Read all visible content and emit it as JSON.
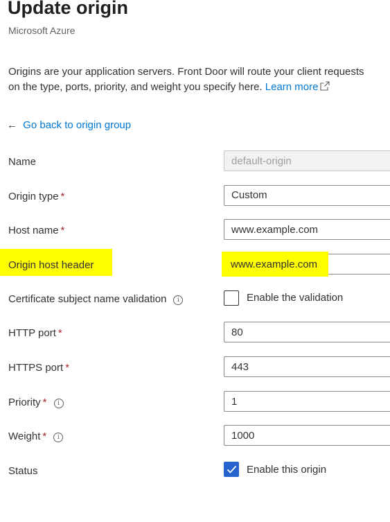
{
  "header": {
    "title": "Update origin",
    "subtitle": "Microsoft Azure"
  },
  "description": {
    "line1": "Origins are your application servers. Front Door will route your client requests",
    "line2": "on the type, ports, priority, and weight you specify here.",
    "learn_more": "Learn more"
  },
  "back_link": "Go back to origin group",
  "form": {
    "name": {
      "label": "Name",
      "value": "default-origin"
    },
    "origin_type": {
      "label": "Origin type",
      "value": "Custom"
    },
    "host_name": {
      "label": "Host name",
      "value": "www.example.com"
    },
    "origin_host_header": {
      "label": "Origin host header",
      "value": "www.example.com"
    },
    "cert_validation": {
      "label": "Certificate subject name validation",
      "checkbox_label": "Enable the validation",
      "checked": false
    },
    "http_port": {
      "label": "HTTP port",
      "value": "80"
    },
    "https_port": {
      "label": "HTTPS port",
      "value": "443"
    },
    "priority": {
      "label": "Priority",
      "value": "1"
    },
    "weight": {
      "label": "Weight",
      "value": "1000"
    },
    "status": {
      "label": "Status",
      "checkbox_label": "Enable this origin",
      "checked": true
    }
  },
  "required_marker": "*",
  "info_glyph": "i",
  "colors": {
    "accent": "#0078d4",
    "highlight": "#ffff00",
    "required": "#a4262c",
    "checkbox_checked": "#2564cf"
  }
}
